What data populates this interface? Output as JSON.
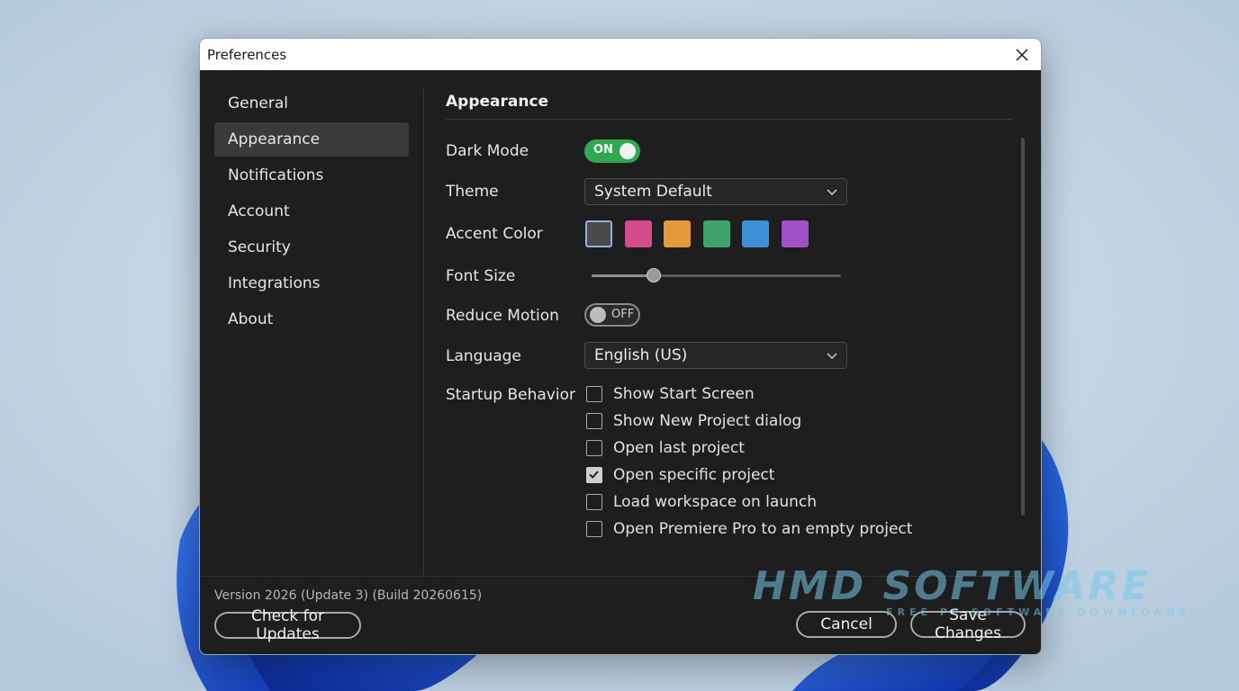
{
  "window": {
    "title": "Preferences"
  },
  "sidebar": {
    "items": [
      {
        "label": "General",
        "active": false
      },
      {
        "label": "Appearance",
        "active": true
      },
      {
        "label": "Notifications",
        "active": false
      },
      {
        "label": "Account",
        "active": false
      },
      {
        "label": "Security",
        "active": false
      },
      {
        "label": "Integrations",
        "active": false
      },
      {
        "label": "About",
        "active": false
      }
    ]
  },
  "main": {
    "section_title": "Appearance",
    "dark_mode": {
      "label": "Dark Mode",
      "state": "ON"
    },
    "theme": {
      "label": "Theme",
      "value": "System Default"
    },
    "accent_color": {
      "label": "Accent Color",
      "swatches": [
        "#4a4a4a",
        "#d44a8a",
        "#e59a3a",
        "#3da36a",
        "#3d8fd6",
        "#a050c8"
      ],
      "selected_index": 0
    },
    "font_size": {
      "label": "Font Size",
      "value_fraction": 0.25
    },
    "reduce_motion": {
      "label": "Reduce Motion",
      "state": "OFF"
    },
    "language": {
      "label": "Language",
      "value": "English (US)"
    },
    "startup": {
      "label": "Startup Behavior",
      "options": [
        {
          "label": "Show Start Screen",
          "checked": false
        },
        {
          "label": "Show New Project dialog",
          "checked": false
        },
        {
          "label": "Open last project",
          "checked": false
        },
        {
          "label": "Open specific project",
          "checked": true
        },
        {
          "label": "Load workspace on launch",
          "checked": false
        },
        {
          "label": "Open Premiere Pro to an empty project",
          "checked": false
        }
      ]
    }
  },
  "footer": {
    "version": "Version 2026 (Update 3) (Build 20260615)",
    "check_updates": "Check for Updates",
    "cancel": "Cancel",
    "save": "Save Changes"
  },
  "watermark": {
    "main": "HMD SOFTWARE",
    "sub": "FREE PC SOFTWARE DOWNLOADS"
  },
  "colors": {
    "on": "#2fa84f",
    "panel": "#1e1e1e"
  }
}
